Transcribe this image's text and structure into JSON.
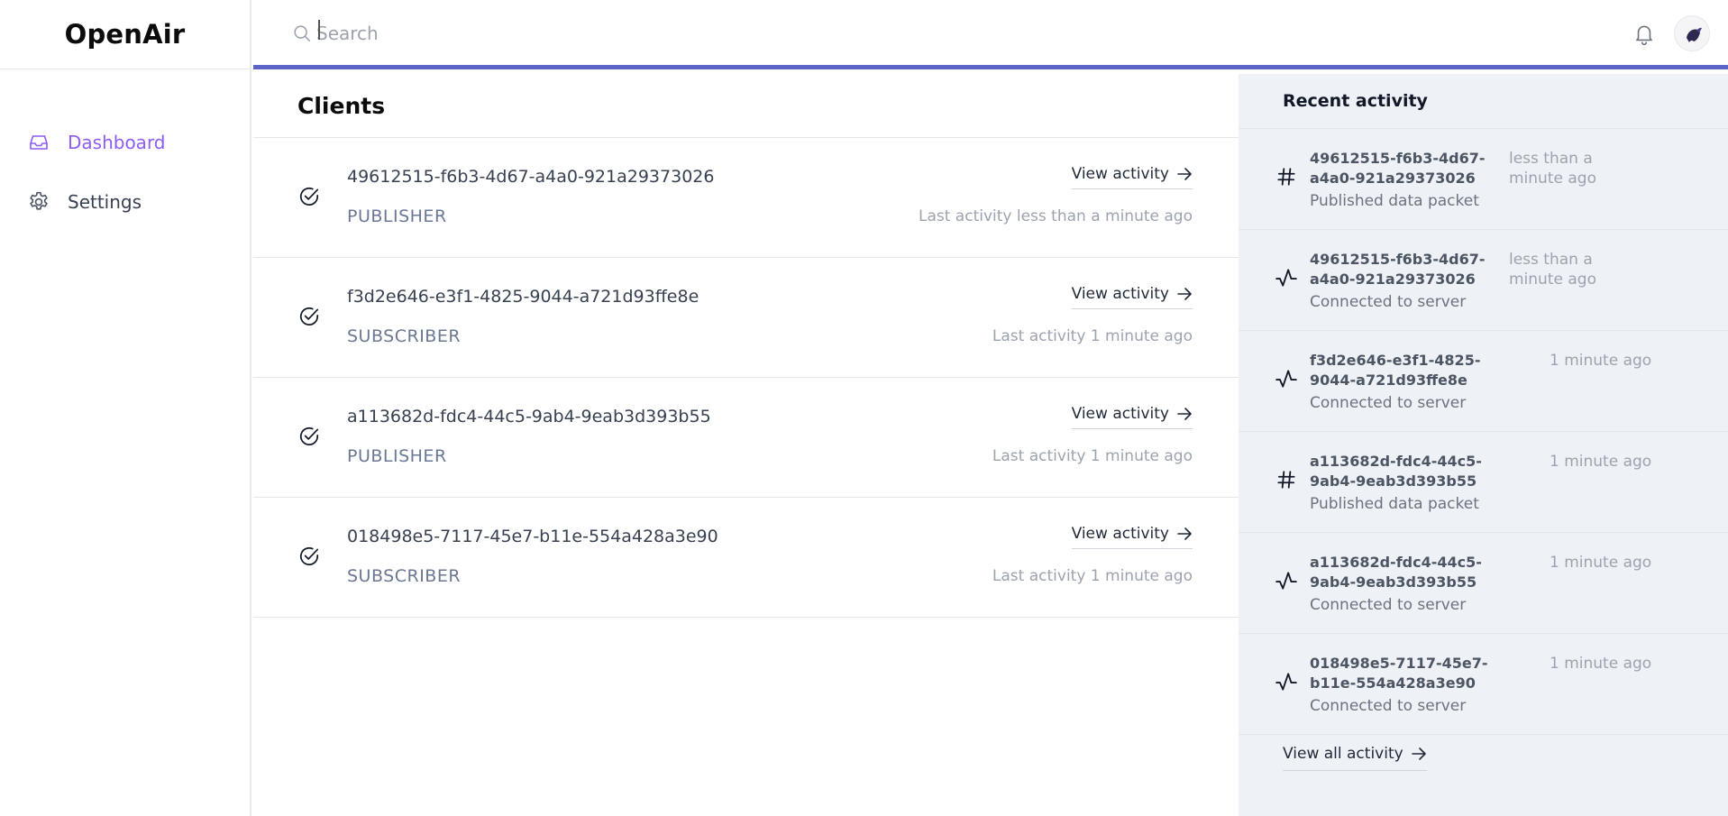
{
  "app": {
    "brand": "OpenAir"
  },
  "sidebar": {
    "items": [
      {
        "label": "Dashboard",
        "icon": "inbox-icon",
        "active": true
      },
      {
        "label": "Settings",
        "icon": "gear-icon",
        "active": false
      }
    ]
  },
  "search": {
    "placeholder": "Search",
    "value": ""
  },
  "main": {
    "title": "Clients",
    "view_label": "View activity",
    "clients": [
      {
        "id": "49612515-f6b3-4d67-a4a0-921a29373026",
        "role": "PUBLISHER",
        "last": "Last activity less than a minute ago"
      },
      {
        "id": "f3d2e646-e3f1-4825-9044-a721d93ffe8e",
        "role": "SUBSCRIBER",
        "last": "Last activity 1 minute ago"
      },
      {
        "id": "a113682d-fdc4-44c5-9ab4-9eab3d393b55",
        "role": "PUBLISHER",
        "last": "Last activity 1 minute ago"
      },
      {
        "id": "018498e5-7117-45e7-b11e-554a428a3e90",
        "role": "SUBSCRIBER",
        "last": "Last activity 1 minute ago"
      }
    ]
  },
  "activity": {
    "title": "Recent activity",
    "view_all": "View all activity",
    "items": [
      {
        "id": "49612515-f6b3-4d67-a4a0-921a29373026",
        "desc": "Published data packet",
        "time": "less than a minute ago",
        "icon": "hash-icon"
      },
      {
        "id": "49612515-f6b3-4d67-a4a0-921a29373026",
        "desc": "Connected to server",
        "time": "less than a minute ago",
        "icon": "pulse-icon"
      },
      {
        "id": "f3d2e646-e3f1-4825-9044-a721d93ffe8e",
        "desc": "Connected to server",
        "time": "1 minute ago",
        "icon": "pulse-icon"
      },
      {
        "id": "a113682d-fdc4-44c5-9ab4-9eab3d393b55",
        "desc": "Published data packet",
        "time": "1 minute ago",
        "icon": "hash-icon"
      },
      {
        "id": "a113682d-fdc4-44c5-9ab4-9eab3d393b55",
        "desc": "Connected to server",
        "time": "1 minute ago",
        "icon": "pulse-icon"
      },
      {
        "id": "018498e5-7117-45e7-b11e-554a428a3e90",
        "desc": "Connected to server",
        "time": "1 minute ago",
        "icon": "pulse-icon"
      }
    ]
  },
  "colors": {
    "accent": "#5b64c9",
    "active_nav": "#8b5cf6",
    "panel_bg": "#eef1f5"
  }
}
